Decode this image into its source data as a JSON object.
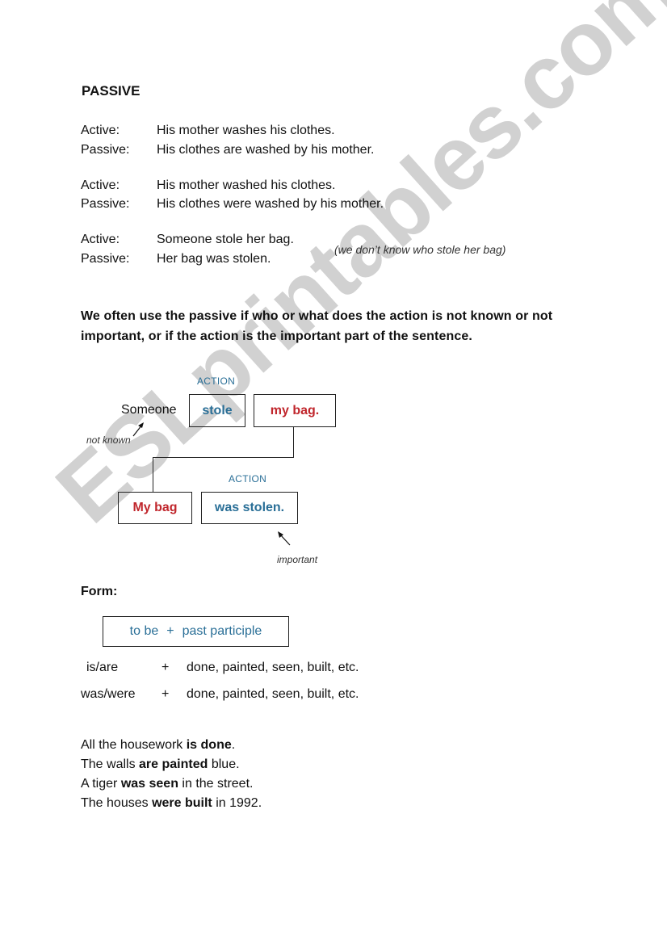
{
  "watermark": "ESLprintables.com",
  "title": "PASSIVE",
  "examples": [
    {
      "label": "Active:",
      "sentence": "His mother washes his clothes."
    },
    {
      "label": "Passive:",
      "sentence": "His clothes are washed by his mother."
    },
    {
      "label": "Active:",
      "sentence": "His mother washed his clothes."
    },
    {
      "label": "Passive:",
      "sentence": "His clothes were washed by his mother."
    },
    {
      "label": "Active:",
      "sentence": "Someone stole her bag."
    },
    {
      "label": "Passive:",
      "sentence": "Her bag was stolen."
    }
  ],
  "note": "(we don’t know who stole her bag)",
  "explanation": {
    "line1": "We often use the passive if who or what does the action is not known or not",
    "line2": "important, or if the action is the important part of the sentence."
  },
  "diagram": {
    "active": {
      "subject": "Someone",
      "subject_note": "not known",
      "action_label": "ACTION",
      "verb": "stole",
      "object": "my bag."
    },
    "passive": {
      "subject": "My bag",
      "action_label": "ACTION",
      "verb": "was stolen.",
      "verb_note": "important"
    },
    "colors": {
      "action": "#2a6f97",
      "object": "#c0262c"
    }
  },
  "form": {
    "heading": "Form:",
    "formula_left": "to be",
    "formula_plus": "+",
    "formula_right": "past participle",
    "rows": [
      {
        "aux": "is/are",
        "plus": "+",
        "participles": "done, painted, seen, built, etc."
      },
      {
        "aux": "was/were",
        "plus": "+",
        "participles": "done, painted, seen, built, etc."
      }
    ]
  },
  "sentences": [
    {
      "pre": "All the housework ",
      "bold": "is done",
      "post": "."
    },
    {
      "pre": "The walls ",
      "bold": "are painted",
      "post": " blue."
    },
    {
      "pre": "A tiger ",
      "bold": "was seen",
      "post": " in the street."
    },
    {
      "pre": "The houses ",
      "bold": "were built",
      "post": " in 1992."
    }
  ]
}
